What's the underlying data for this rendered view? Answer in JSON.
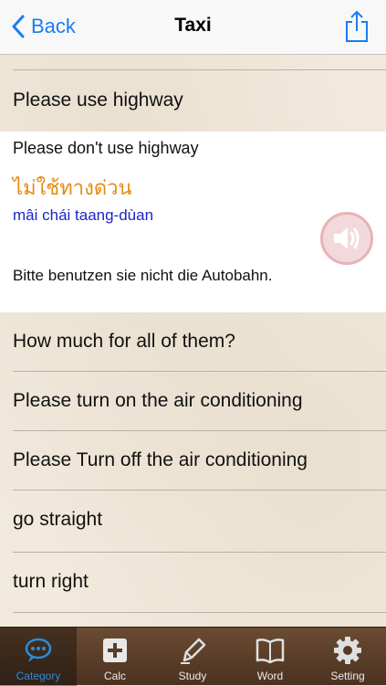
{
  "navbar": {
    "back_label": "Back",
    "title": "Taxi"
  },
  "rows": {
    "r1": "Please use highway",
    "r3": "How much for all of them?",
    "r4": "Please turn on the air conditioning",
    "r5": "Please Turn off the air conditioning",
    "r6": "go straight",
    "r7": "turn right"
  },
  "expanded": {
    "english": "Please don't use highway",
    "thai": "ไม่ใช้ทางด่วน",
    "romanization": "mâi chái taang-dùan",
    "german": "Bitte benutzen sie nicht die Autobahn."
  },
  "tabbar": {
    "category": "Category",
    "calc": "Calc",
    "study": "Study",
    "word": "Word",
    "setting": "Setting"
  },
  "colors": {
    "accent": "#1a7cf3",
    "thai_text": "#e58b12",
    "romanization_text": "#1a25c9",
    "tab_active": "#2b8ce0"
  }
}
